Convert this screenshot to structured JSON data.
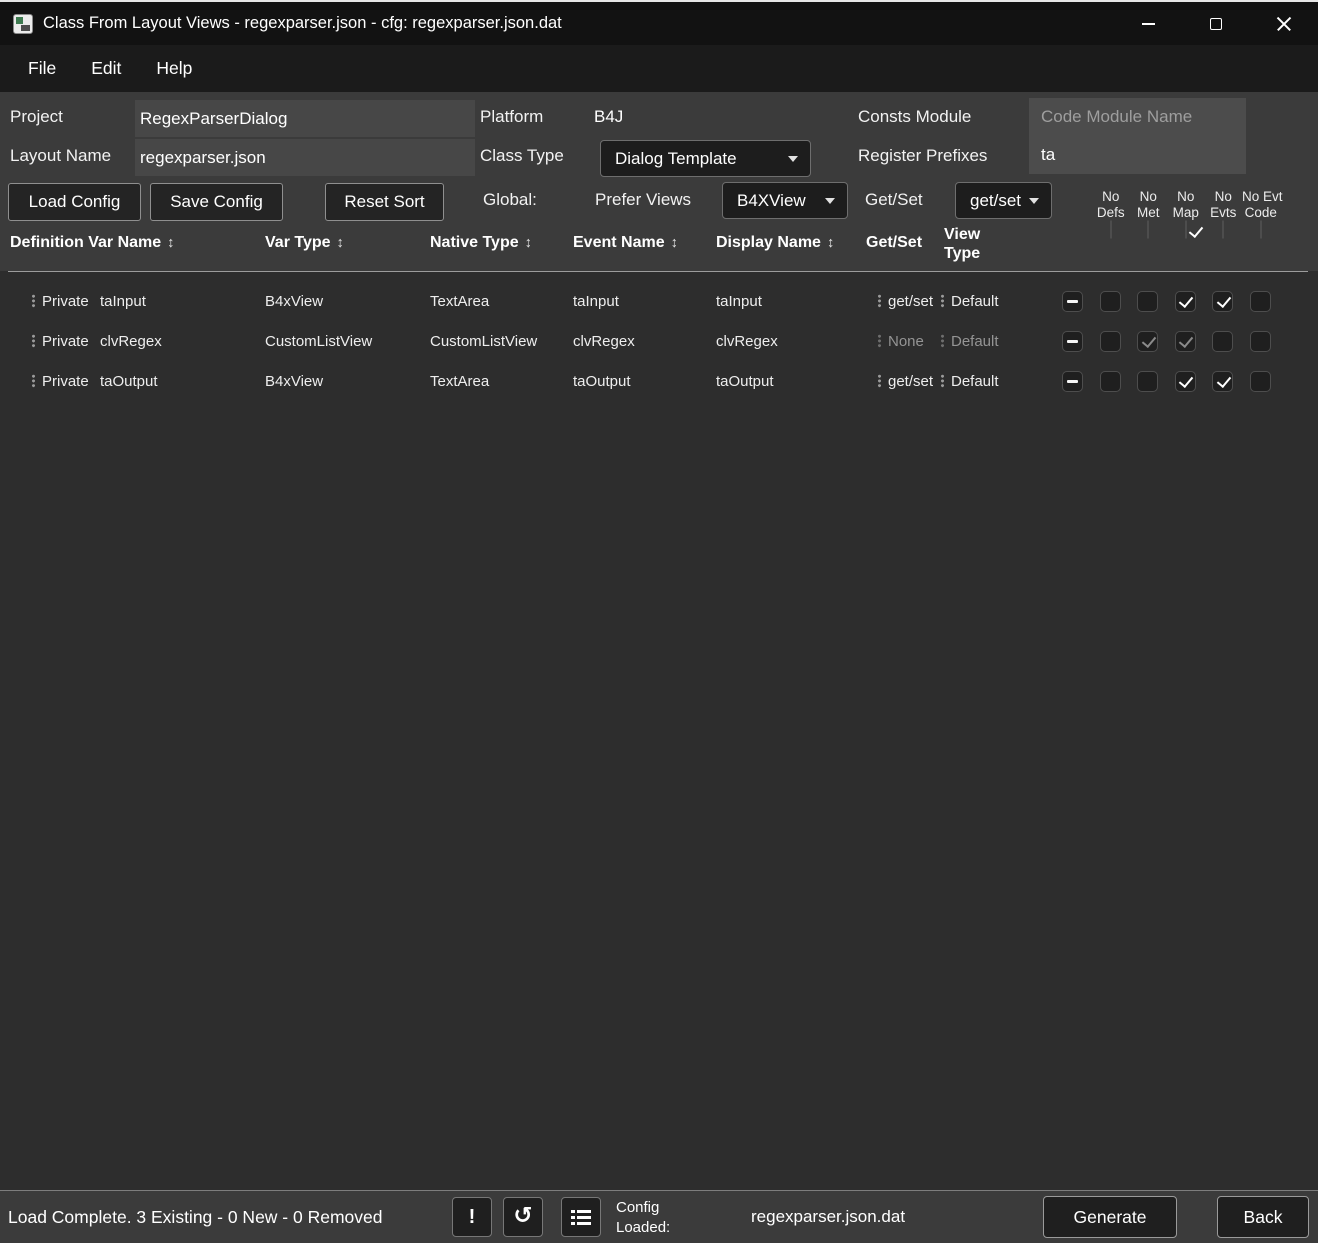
{
  "window": {
    "title": "Class From Layout Views - regexparser.json - cfg: regexparser.json.dat"
  },
  "menu": {
    "items": [
      "File",
      "Edit",
      "Help"
    ]
  },
  "form": {
    "project": {
      "label": "Project",
      "value": "RegexParserDialog"
    },
    "layout_name": {
      "label": "Layout Name",
      "value": "regexparser.json"
    },
    "platform": {
      "label": "Platform",
      "value": "B4J"
    },
    "class_type": {
      "label": "Class Type",
      "value": "Dialog Template"
    },
    "consts_module": {
      "label": "Consts Module",
      "placeholder": "Code Module Name"
    },
    "register_prefixes": {
      "label": "Register Prefixes",
      "value": "ta"
    },
    "load_config_label": "Load Config",
    "save_config_label": "Save Config",
    "reset_sort_label": "Reset Sort",
    "global_label": "Global:",
    "prefer_views": {
      "label": "Prefer Views",
      "value": "B4XView"
    },
    "getset": {
      "label": "Get/Set",
      "value": "get/set"
    },
    "flags": [
      {
        "line1": "No",
        "line2": "Defs",
        "state": "empty"
      },
      {
        "line1": "No",
        "line2": "Met",
        "state": "dash"
      },
      {
        "line1": "No",
        "line2": "Map",
        "state": "check"
      },
      {
        "line1": "No",
        "line2": "Evts",
        "state": "dash"
      },
      {
        "line1": "No Evt",
        "line2": "Code",
        "state": "empty"
      }
    ]
  },
  "table": {
    "headers": {
      "definition": "Definition Var Name",
      "var_type": "Var Type",
      "native_type": "Native Type",
      "event_name": "Event Name",
      "display_name": "Display Name",
      "getset": "Get/Set",
      "view_type_line1": "View",
      "view_type_line2": "Type",
      "sort_glyph": "↕"
    },
    "rows": [
      {
        "access": "Private",
        "var_name": "taInput",
        "var_type": "B4xView",
        "native_type": "TextArea",
        "event_name": "taInput",
        "display_name": "taInput",
        "getset": "get/set",
        "view_type": "Default",
        "disabled": false,
        "checks": [
          "dash",
          "empty",
          "empty",
          "check",
          "check",
          "empty"
        ]
      },
      {
        "access": "Private",
        "var_name": "clvRegex",
        "var_type": "CustomListView",
        "native_type": "CustomListView",
        "event_name": "clvRegex",
        "display_name": "clvRegex",
        "getset": "None",
        "view_type": "Default",
        "disabled": true,
        "checks": [
          "dash",
          "empty",
          "check-dim",
          "check-dim",
          "empty",
          "empty"
        ]
      },
      {
        "access": "Private",
        "var_name": "taOutput",
        "var_type": "B4xView",
        "native_type": "TextArea",
        "event_name": "taOutput",
        "display_name": "taOutput",
        "getset": "get/set",
        "view_type": "Default",
        "disabled": false,
        "checks": [
          "dash",
          "empty",
          "empty",
          "check",
          "check",
          "empty"
        ]
      }
    ]
  },
  "statusbar": {
    "status_text": "Load Complete. 3 Existing - 0 New - 0 Removed",
    "warning_glyph": "!",
    "undo_glyph": "↺",
    "config_loaded_line1": "Config",
    "config_loaded_line2": "Loaded:",
    "config_file": "regexparser.json.dat",
    "generate_label": "Generate",
    "back_label": "Back"
  },
  "colors": {
    "form_bg": "#3b3b3b",
    "body_bg": "#2d2d2d",
    "titlebar_bg": "#121212",
    "check_mark": "#ffffff",
    "disabled_text": "#9a9a9a"
  }
}
